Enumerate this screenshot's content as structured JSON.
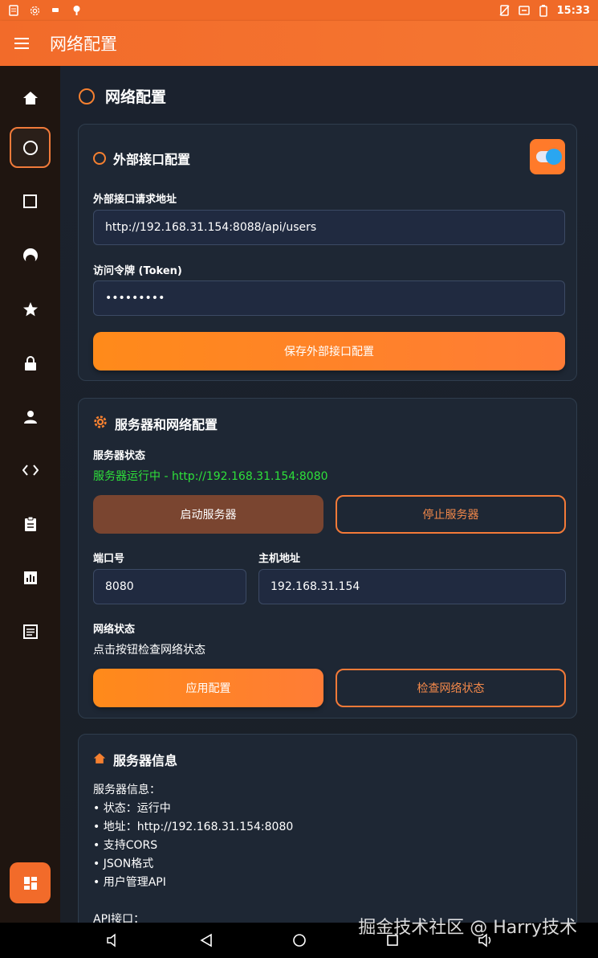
{
  "status_bar": {
    "time": "15:33",
    "left_icons": [
      "doc-icon",
      "gear-icon",
      "cat-icon",
      "android-icon"
    ],
    "right_icons": [
      "no-sim-icon",
      "rotate-icon",
      "battery-icon"
    ]
  },
  "app_bar": {
    "title": "网络配置",
    "menu_icon": "hamburger-icon"
  },
  "rail": {
    "items": [
      "home-icon",
      "circle-icon",
      "square-icon",
      "moon-icon",
      "star-icon",
      "lock-icon",
      "person-icon",
      "code-icon",
      "clipboard-icon",
      "chart-icon",
      "article-icon"
    ],
    "active_index": 1,
    "fab_icon": "dashboard-icon"
  },
  "page": {
    "title": "网络配置"
  },
  "external": {
    "title": "外部接口配置",
    "toggle_on": true,
    "url_label": "外部接口请求地址",
    "url_value": "http://192.168.31.154:8088/api/users",
    "token_label": "访问令牌 (Token)",
    "token_value": "•••••••••",
    "save_button": "保存外部接口配置"
  },
  "server": {
    "title": "服务器和网络配置",
    "status_label": "服务器状态",
    "status_value": "服务器运行中 - http://192.168.31.154:8080",
    "start_button": "启动服务器",
    "stop_button": "停止服务器",
    "port_label": "端口号",
    "port_value": "8080",
    "host_label": "主机地址",
    "host_value": "192.168.31.154",
    "network_label": "网络状态",
    "network_value": "点击按钮检查网络状态",
    "apply_button": "应用配置",
    "check_button": "检查网络状态"
  },
  "info": {
    "title": "服务器信息",
    "lines": [
      "服务器信息：",
      "• 状态：运行中",
      "• 地址：http://192.168.31.154:8080",
      "• 支持CORS",
      "• JSON格式",
      "• 用户管理API",
      "",
      "API接口："
    ]
  },
  "watermark": "掘金技术社区 @ Harry技术",
  "colors": {
    "accent": "#f26b2a",
    "success": "#2ee03a",
    "card": "#1e2734"
  }
}
